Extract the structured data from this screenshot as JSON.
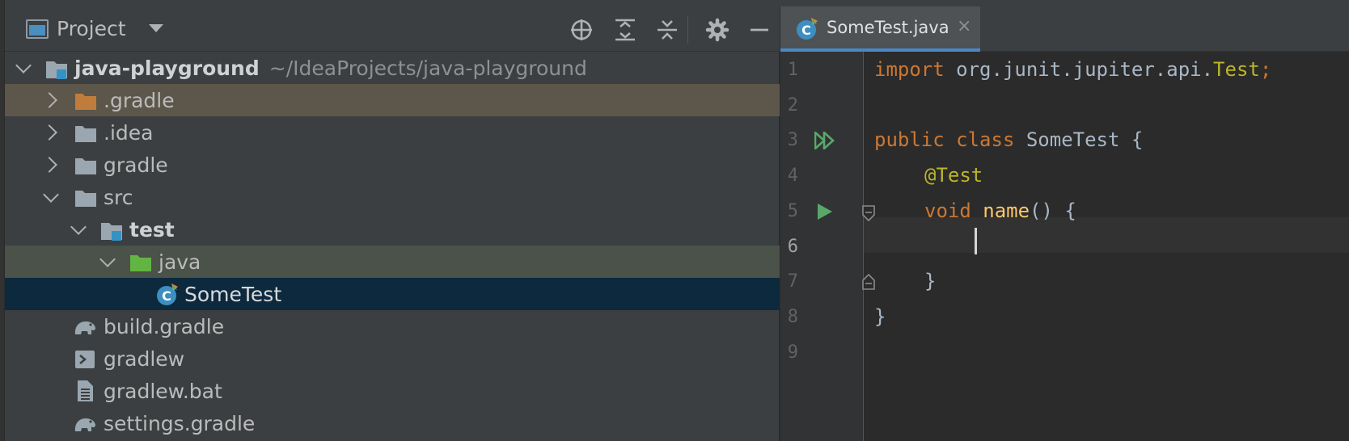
{
  "project_panel": {
    "title": "Project",
    "toolbar": [
      "locate-icon",
      "expand-all-icon",
      "collapse-all-icon",
      "gear-icon",
      "hide-icon"
    ],
    "tree": [
      {
        "label": "java-playground",
        "path": "~/IdeaProjects/java-playground",
        "icon": "module-folder-icon",
        "expanded": true,
        "bold": true
      },
      {
        "label": ".gradle",
        "icon": "folder-icon",
        "color": "#c07c3c",
        "expanded": false
      },
      {
        "label": ".idea",
        "icon": "folder-icon",
        "expanded": false
      },
      {
        "label": "gradle",
        "icon": "folder-icon",
        "expanded": false
      },
      {
        "label": "src",
        "icon": "folder-icon",
        "expanded": true
      },
      {
        "label": "test",
        "icon": "module-folder-icon",
        "expanded": true,
        "bold": true
      },
      {
        "label": "java",
        "icon": "test-source-folder-icon",
        "color": "#62b543",
        "expanded": true
      },
      {
        "label": "SomeTest",
        "icon": "java-class-icon",
        "selected": true
      },
      {
        "label": "build.gradle",
        "icon": "gradle-elephant-icon"
      },
      {
        "label": "gradlew",
        "icon": "shell-script-icon"
      },
      {
        "label": "gradlew.bat",
        "icon": "text-file-icon"
      },
      {
        "label": "settings.gradle",
        "icon": "gradle-elephant-icon"
      }
    ]
  },
  "editor": {
    "tab": {
      "label": "SomeTest.java",
      "close": "×"
    },
    "line_numbers": [
      "1",
      "2",
      "3",
      "4",
      "5",
      "6",
      "7",
      "8",
      "9"
    ],
    "current_line": 6,
    "code": {
      "l1_kw": "import",
      "l1_rest": " org.junit.jupiter.api.",
      "l1_ann": "Test",
      "l1_semi": ";",
      "l3_kw": "public class",
      "l3_rest": " SomeTest {",
      "l4_ann": "@Test",
      "l5_kw": "void",
      "l5_fn": "name",
      "l5_rest": "() {",
      "l7": "}",
      "l8": "}"
    },
    "colors": {
      "keyword": "#cc7832",
      "annotation": "#bbb529",
      "method": "#ffc66d",
      "run_gutter": "#59a869",
      "selection": "#0d293e"
    }
  }
}
